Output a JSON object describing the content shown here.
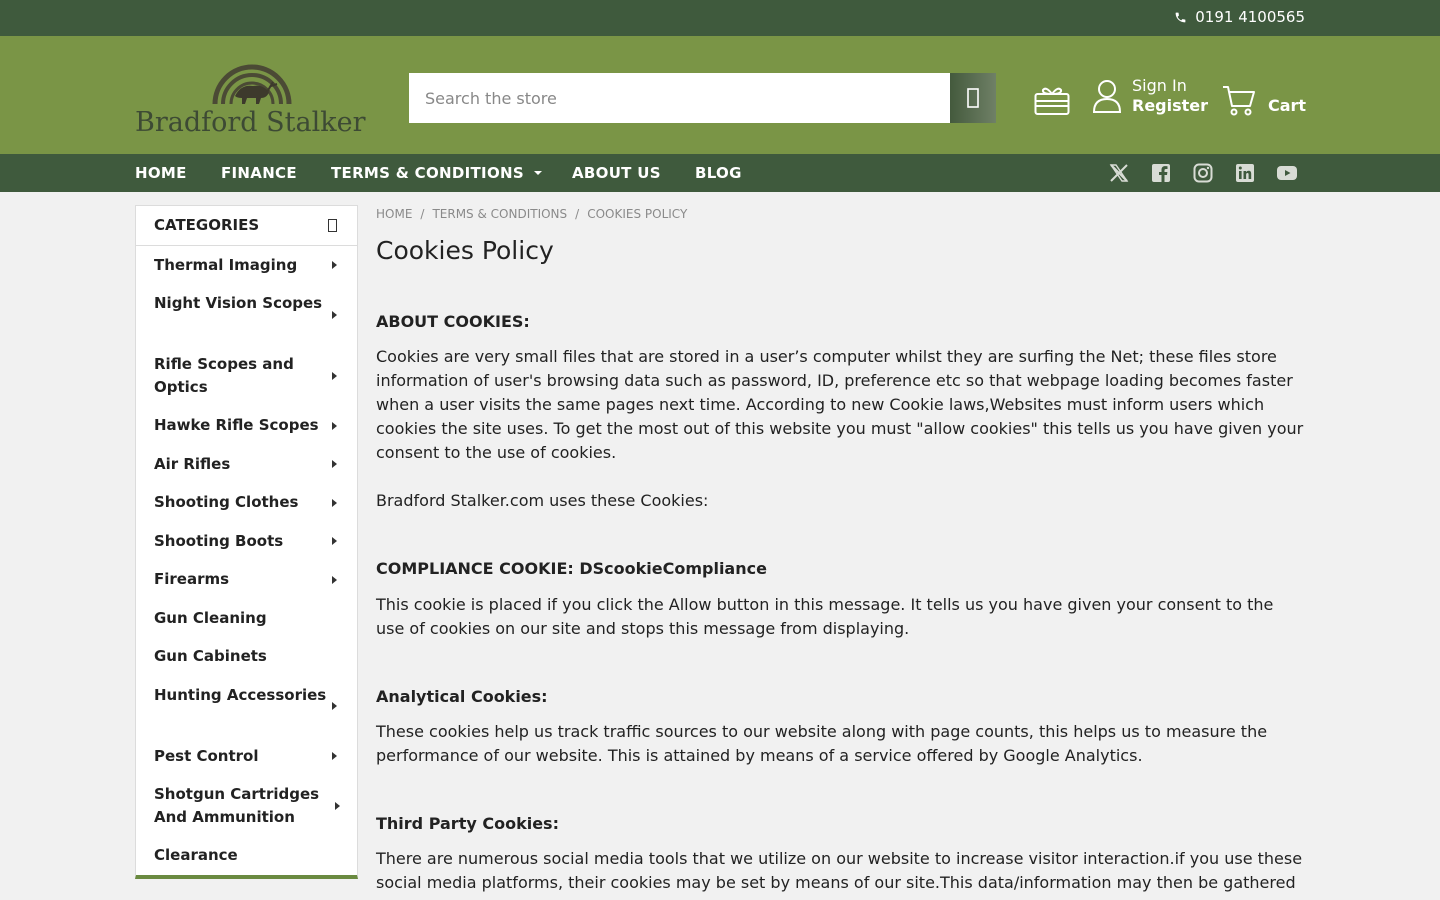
{
  "topbar": {
    "phone": "0191 4100565"
  },
  "header": {
    "logo_text": "Bradford Stalker",
    "search_placeholder": "Search the store",
    "sign_in": "Sign In",
    "register": "Register",
    "cart": "Cart"
  },
  "nav": {
    "items": [
      "HOME",
      "FINANCE",
      "TERMS & CONDITIONS",
      "ABOUT US",
      "BLOG"
    ],
    "social_icons": [
      "x-icon",
      "facebook-icon",
      "instagram-icon",
      "linkedin-icon",
      "youtube-icon"
    ]
  },
  "sidebar": {
    "title": "CATEGORIES",
    "items": [
      "Thermal Imaging",
      "Night Vision Scopes",
      "Rifle Scopes and Optics",
      "Hawke Rifle Scopes",
      "Air Rifles",
      "Shooting Clothes",
      "Shooting Boots",
      "Firearms",
      "Gun Cleaning",
      "Gun Cabinets",
      "Hunting Accessories",
      "Pest Control",
      "Shotgun Cartridges And Ammunition",
      "Clearance"
    ]
  },
  "breadcrumb": [
    "HOME",
    "TERMS & CONDITIONS",
    "COOKIES POLICY"
  ],
  "page": {
    "title": "Cookies Policy",
    "about_head": "ABOUT COOKIES:",
    "about_text": "Cookies are very small files that are stored in a user’s computer whilst they are surfing the Net; these files store information of user's browsing data such as password, ID, preference etc so that webpage loading becomes faster when a user visits the same pages next time. According to new Cookie laws,Websites must inform users which cookies the site uses. To get the most out of this website you must \"allow cookies\" this tells us you have given your consent to the use of cookies.",
    "uses_text": "Bradford Stalker.com uses these Cookies:",
    "compliance_head": "COMPLIANCE COOKIE: DScookieCompliance",
    "compliance_text": "This cookie is placed if you click the Allow button in this message. It tells us you have given your consent to the use of cookies on our site and stops this message from displaying.",
    "analytical_head": "Analytical Cookies:",
    "analytical_text": "These cookies help us track traffic sources to our website along with page counts, this helps us to measure the performance of our website. This is attained by means of a service offered by Google Analytics.",
    "third_head": "Third Party Cookies:",
    "third_text": "There are numerous social media tools that we utilize on our website to increase visitor interaction.if you use these social media platforms, their cookies may be set by means of our site.This data/information may then be gathered"
  },
  "colors": {
    "topbar": "#3f5a3d",
    "header": "#7a9546",
    "nav": "#3f5a3d",
    "sidebar_accent": "#6a8a40"
  }
}
